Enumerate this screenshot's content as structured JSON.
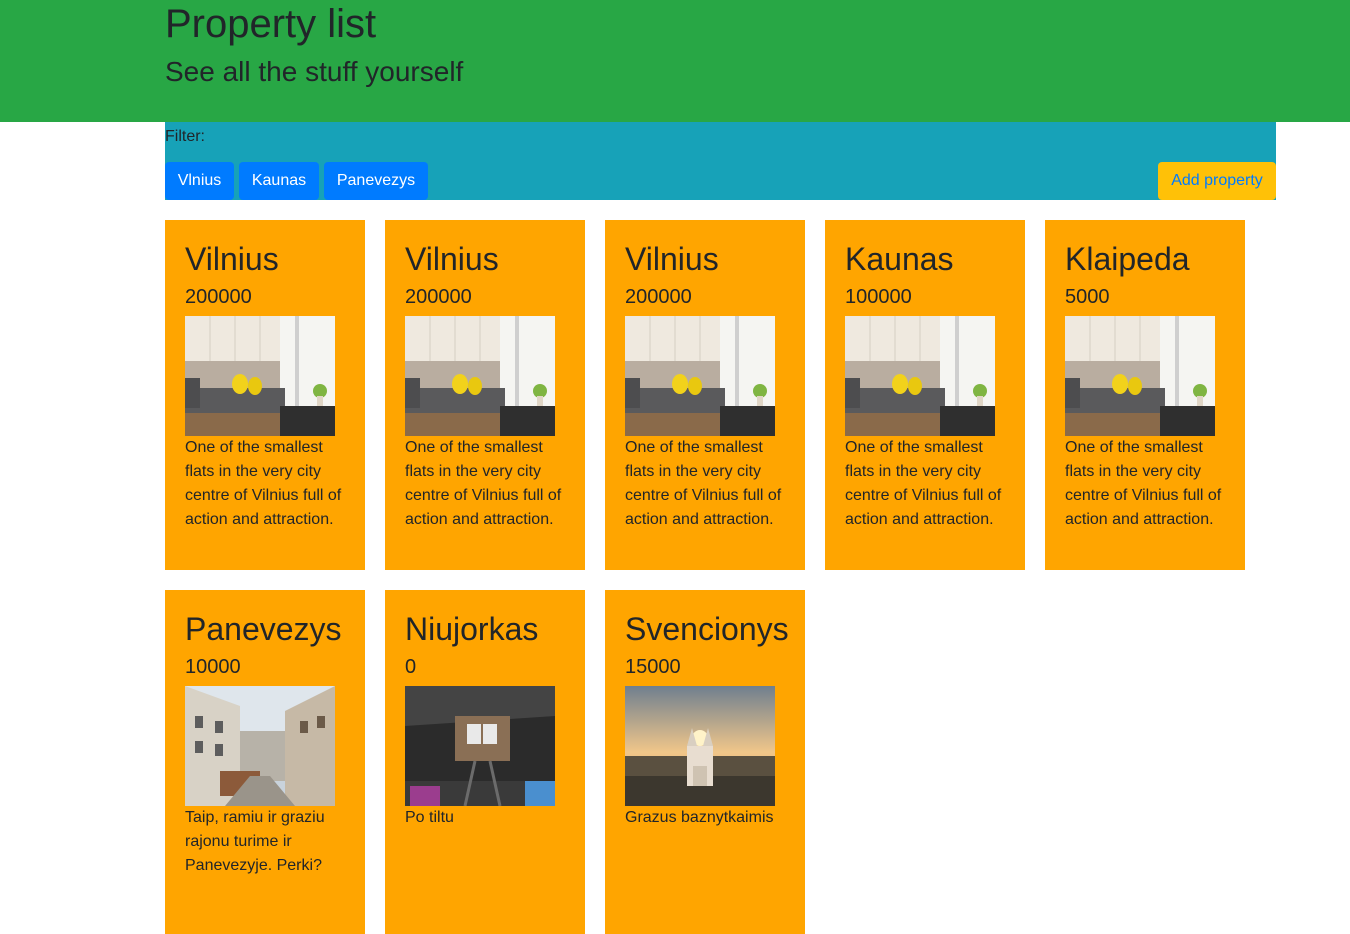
{
  "header": {
    "title": "Property list",
    "subtitle": "See all the stuff yourself"
  },
  "filter": {
    "label": "Filter:",
    "buttons": [
      "Vlnius",
      "Kaunas",
      "Panevezys"
    ],
    "add_label": "Add property"
  },
  "colors": {
    "header_bg": "#28a745",
    "filter_bg": "#17a2b8",
    "card_bg": "#ffa500",
    "filter_button_bg": "#007bff",
    "add_button_bg": "#ffc107"
  },
  "properties": [
    {
      "city": "Vilnius",
      "price": "200000",
      "photo": "apartment-interior",
      "description": "One of the smallest flats in the very city centre of Vilnius full of action and attraction."
    },
    {
      "city": "Vilnius",
      "price": "200000",
      "photo": "apartment-interior",
      "description": "One of the smallest flats in the very city centre of Vilnius full of action and attraction."
    },
    {
      "city": "Vilnius",
      "price": "200000",
      "photo": "apartment-interior",
      "description": "One of the smallest flats in the very city centre of Vilnius full of action and attraction."
    },
    {
      "city": "Kaunas",
      "price": "100000",
      "photo": "apartment-interior",
      "description": "One of the smallest flats in the very city centre of Vilnius full of action and attraction."
    },
    {
      "city": "Klaipeda",
      "price": "5000",
      "photo": "apartment-interior",
      "description": "One of the smallest flats in the very city centre of Vilnius full of action and attraction."
    },
    {
      "city": "Panevezys",
      "price": "10000",
      "photo": "street-view",
      "description": "Taip, ramiu ir graziu rajonu turime ir Panevezyje. Perki?"
    },
    {
      "city": "Niujorkas",
      "price": "0",
      "photo": "under-bridge",
      "description": "Po tiltu"
    },
    {
      "city": "Svencionys",
      "price": "15000",
      "photo": "church-sunset",
      "description": "Grazus baznytkaimis"
    }
  ]
}
